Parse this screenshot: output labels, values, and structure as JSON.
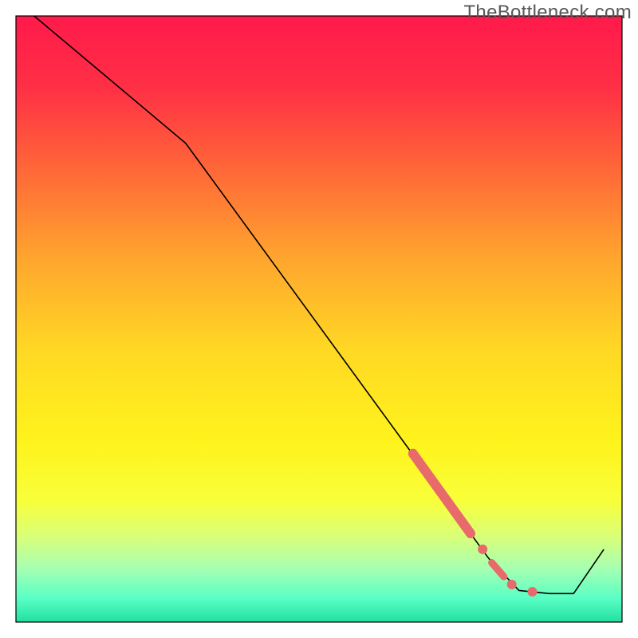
{
  "watermark": "TheBottleneck.com",
  "chart_data": {
    "type": "line",
    "title": "",
    "xlabel": "",
    "ylabel": "",
    "xlim": [
      0,
      100
    ],
    "ylim": [
      0,
      100
    ],
    "background_gradient": {
      "type": "vertical",
      "stops": [
        {
          "offset": 0.0,
          "color": "#ff1a4b"
        },
        {
          "offset": 0.12,
          "color": "#ff3045"
        },
        {
          "offset": 0.25,
          "color": "#ff6638"
        },
        {
          "offset": 0.4,
          "color": "#ffa52e"
        },
        {
          "offset": 0.55,
          "color": "#ffd824"
        },
        {
          "offset": 0.7,
          "color": "#fff31c"
        },
        {
          "offset": 0.8,
          "color": "#f8ff3a"
        },
        {
          "offset": 0.86,
          "color": "#d8ff7a"
        },
        {
          "offset": 0.91,
          "color": "#a8ffb0"
        },
        {
          "offset": 0.96,
          "color": "#5bffc5"
        },
        {
          "offset": 1.0,
          "color": "#22e0a0"
        }
      ]
    },
    "series": [
      {
        "name": "bottleneck-curve",
        "color": "#000000",
        "width_thin": 1.6,
        "points": [
          {
            "x": 3,
            "y": 100
          },
          {
            "x": 28,
            "y": 79
          },
          {
            "x": 78,
            "y": 10.5
          },
          {
            "x": 83,
            "y": 5.2
          },
          {
            "x": 88,
            "y": 4.7
          },
          {
            "x": 92,
            "y": 4.7
          },
          {
            "x": 97,
            "y": 12
          }
        ]
      }
    ],
    "highlight_segments": [
      {
        "name": "thick-segment-main",
        "color": "#e86a6a",
        "width": 12,
        "points": [
          {
            "x": 65.5,
            "y": 27.8
          },
          {
            "x": 75.0,
            "y": 14.6
          }
        ]
      },
      {
        "name": "thick-segment-small",
        "color": "#e86a6a",
        "width": 9,
        "points": [
          {
            "x": 78.5,
            "y": 9.8
          },
          {
            "x": 80.5,
            "y": 7.5
          }
        ]
      }
    ],
    "dots": [
      {
        "name": "dot-a",
        "x": 77.0,
        "y": 12.0,
        "r": 6,
        "color": "#e86a6a"
      },
      {
        "name": "dot-b",
        "x": 81.8,
        "y": 6.2,
        "r": 6,
        "color": "#e86a6a"
      },
      {
        "name": "dot-c",
        "x": 85.2,
        "y": 5.0,
        "r": 6,
        "color": "#e86a6a"
      }
    ],
    "frame": {
      "color": "#000000",
      "width": 1.2
    }
  }
}
